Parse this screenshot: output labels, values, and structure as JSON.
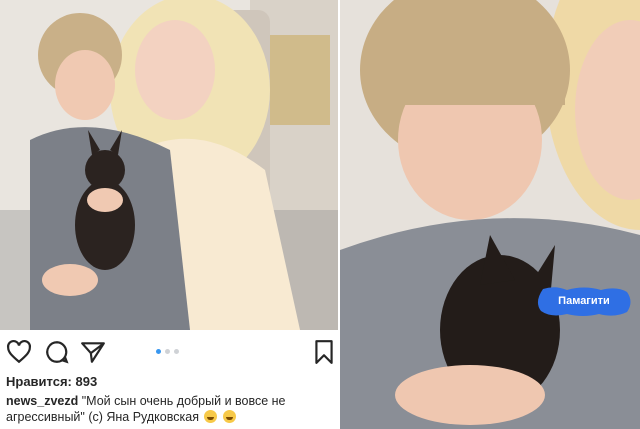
{
  "post": {
    "likes_text": "Нравится: 893",
    "username": "news_zvezd",
    "caption_text": " \"Мой сын очень добрый и вовсе не агрессивный\" (с) Яна Рудковская",
    "emojis": [
      "grinning-face-emoji",
      "tears-of-joy-emoji"
    ]
  },
  "carousel": {
    "total": 3,
    "active": 1
  },
  "overlay": {
    "bubble_text": "Памагити"
  },
  "icons": [
    "heart-icon",
    "comment-icon",
    "share-icon",
    "bookmark-icon"
  ],
  "colors": {
    "accent": "#3897f0",
    "bubble": "#2f6fe4",
    "text": "#262626"
  }
}
